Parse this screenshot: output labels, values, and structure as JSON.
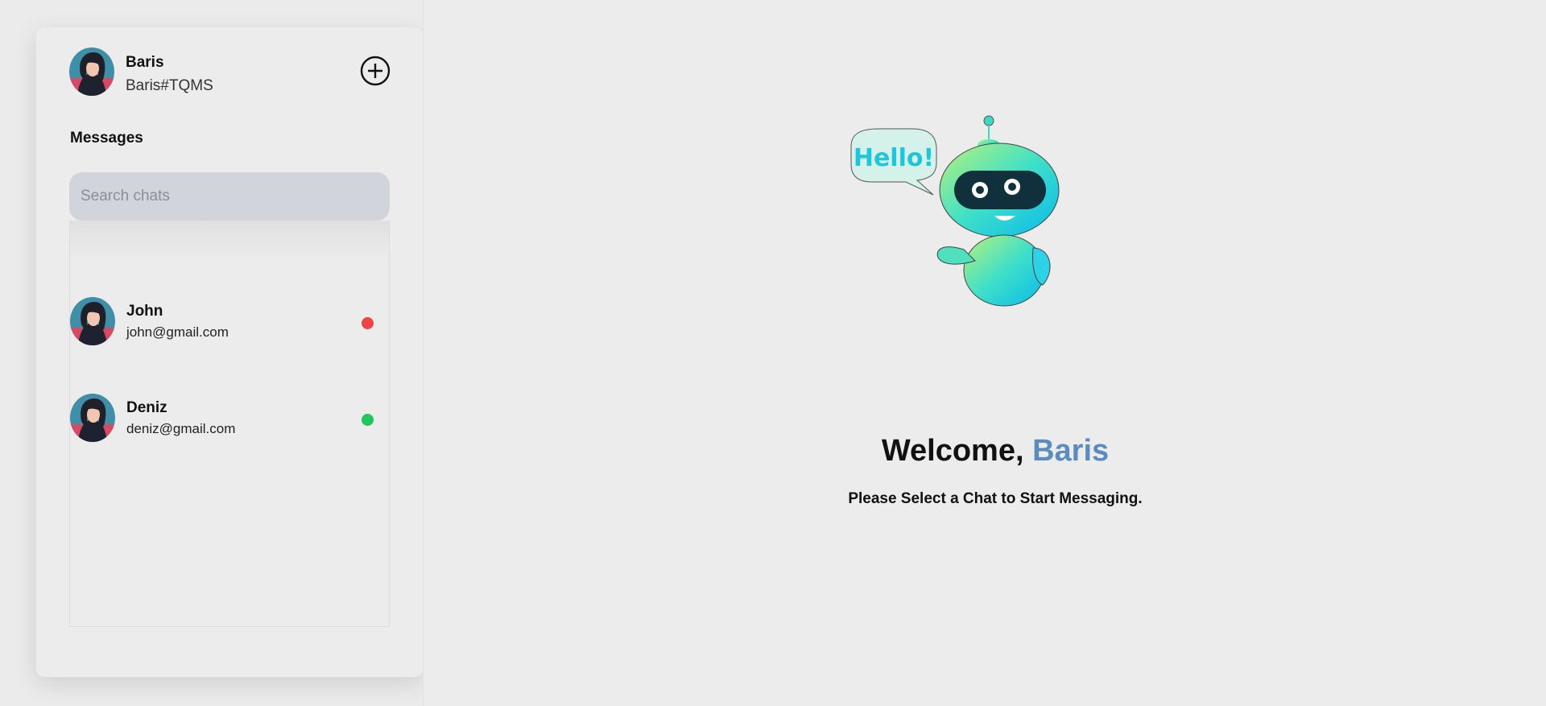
{
  "profile": {
    "name": "Baris",
    "tag": "Baris#TQMS"
  },
  "sidebar": {
    "title": "Messages",
    "search_placeholder": "Search chats",
    "chats": [
      {
        "name": "John",
        "email": "john@gmail.com",
        "status": "offline",
        "status_color": "#ef4444"
      },
      {
        "name": "Deniz",
        "email": "deniz@gmail.com",
        "status": "online",
        "status_color": "#22c55e"
      }
    ]
  },
  "main": {
    "illustration": {
      "bubble_text": "Hello!",
      "icon": "robot-icon"
    },
    "welcome_prefix": "Welcome,",
    "welcome_name": "Baris",
    "subtitle": "Please Select a Chat to Start Messaging."
  },
  "colors": {
    "accent": "#5b8cbf",
    "search_bg": "#d1d4db",
    "offline": "#ef4444",
    "online": "#22c55e"
  },
  "icons": [
    "add-circle-icon",
    "avatar",
    "robot-icon",
    "status-dot"
  ]
}
